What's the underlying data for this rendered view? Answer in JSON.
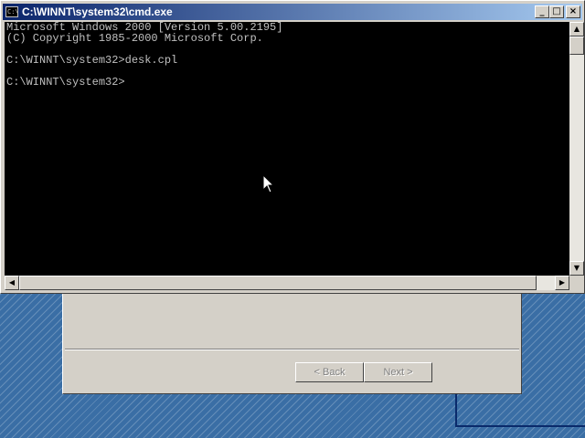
{
  "window": {
    "title": "C:\\WINNT\\system32\\cmd.exe",
    "icon_label": "C:\\",
    "minimize_glyph": "_",
    "maximize_glyph": "□",
    "close_glyph": "×"
  },
  "console": {
    "lines": [
      "Microsoft Windows 2000 [Version 5.00.2195]",
      "(C) Copyright 1985-2000 Microsoft Corp.",
      "",
      "C:\\WINNT\\system32>desk.cpl",
      "",
      "C:\\WINNT\\system32>"
    ],
    "text_color": "#c0c0c0",
    "background": "#000000"
  },
  "scrollbars": {
    "up_arrow": "▲",
    "down_arrow": "▼",
    "left_arrow": "◀",
    "right_arrow": "▶"
  },
  "wizard": {
    "back_label": "< Back",
    "next_label": "Next >"
  },
  "colors": {
    "desktop": "#3a6ea5",
    "titlebar_start": "#0a246a",
    "titlebar_end": "#a6caf0",
    "face": "#d4d0c8"
  },
  "icons": [
    "console-app-icon",
    "minimize-icon",
    "maximize-icon",
    "close-icon",
    "mouse-pointer-icon"
  ]
}
